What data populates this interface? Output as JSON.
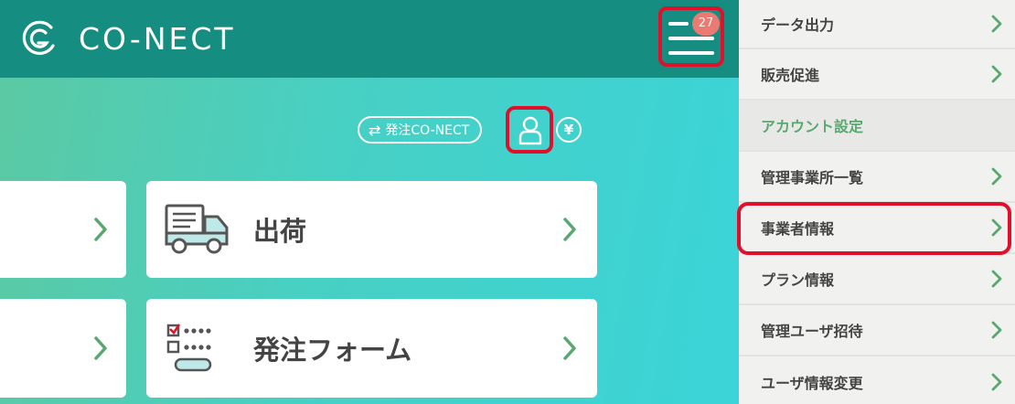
{
  "brand": {
    "name": "CO-NECT"
  },
  "header": {
    "notification_count": "27"
  },
  "toolbar": {
    "switch_label": "発注CO-NECT",
    "yen_label": "¥"
  },
  "cards": [
    {
      "label": "出荷",
      "icon": "truck-icon"
    },
    {
      "label": "発注フォーム",
      "icon": "order-form-icon"
    }
  ],
  "menu": {
    "items": [
      {
        "label": "データ出力"
      },
      {
        "label": "販売促進"
      },
      {
        "label": "アカウント設定",
        "section": true
      },
      {
        "label": "管理事業所一覧"
      },
      {
        "label": "事業者情報",
        "highlighted": true
      },
      {
        "label": "プラン情報"
      },
      {
        "label": "管理ユーザ招待"
      },
      {
        "label": "ユーザ情報変更"
      }
    ]
  },
  "colors": {
    "header": "#158e81",
    "accent_green": "#5aa870",
    "highlight_red": "#e0102a",
    "badge": "#ea7a72"
  }
}
